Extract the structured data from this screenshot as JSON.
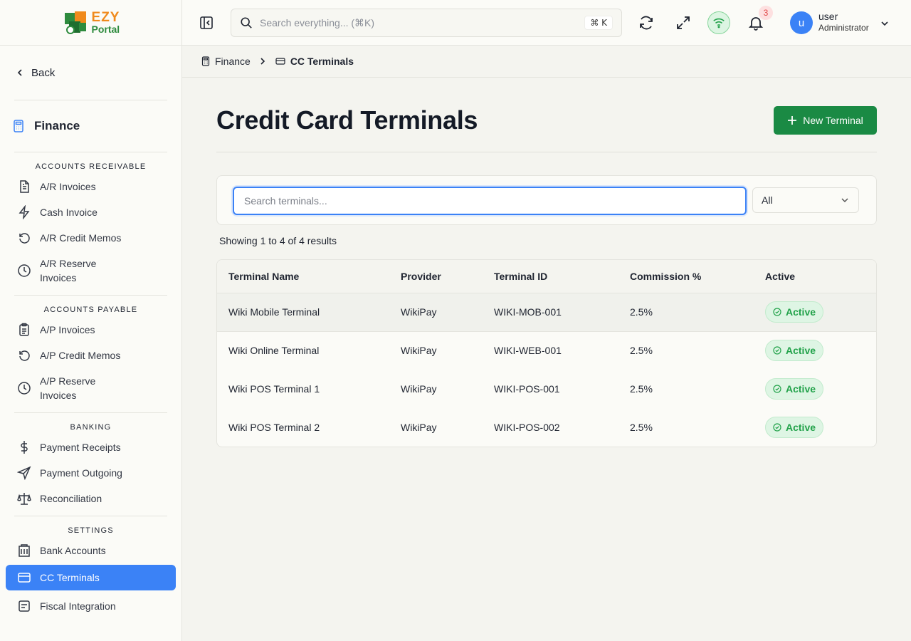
{
  "app": {
    "logo_line1": "EZY",
    "logo_line2": "Portal"
  },
  "sidebar": {
    "back_label": "Back",
    "section_title": "Finance",
    "groups": [
      {
        "title": "ACCOUNTS RECEIVABLE",
        "items": [
          {
            "label": "A/R Invoices",
            "icon": "document-icon"
          },
          {
            "label": "Cash Invoice",
            "icon": "lightning-icon"
          },
          {
            "label": "A/R Credit Memos",
            "icon": "rotate-ccw-icon"
          },
          {
            "label": "A/R Reserve Invoices",
            "icon": "clock-icon"
          }
        ]
      },
      {
        "title": "ACCOUNTS PAYABLE",
        "items": [
          {
            "label": "A/P Invoices",
            "icon": "clipboard-icon"
          },
          {
            "label": "A/P Credit Memos",
            "icon": "rotate-ccw-icon"
          },
          {
            "label": "A/P Reserve Invoices",
            "icon": "clock-icon"
          }
        ]
      },
      {
        "title": "BANKING",
        "items": [
          {
            "label": "Payment Receipts",
            "icon": "dollar-icon"
          },
          {
            "label": "Payment Outgoing",
            "icon": "send-icon"
          },
          {
            "label": "Reconciliation",
            "icon": "scale-icon"
          }
        ]
      },
      {
        "title": "SETTINGS",
        "items": [
          {
            "label": "Bank Accounts",
            "icon": "bank-icon"
          },
          {
            "label": "CC Terminals",
            "icon": "credit-card-icon",
            "active": true
          },
          {
            "label": "Fiscal Integration",
            "icon": "receipt-icon"
          }
        ]
      }
    ]
  },
  "topbar": {
    "search_placeholder": "Search everything... (⌘K)",
    "kbd_hint": "⌘ K",
    "notification_count": "3",
    "user_initial": "u",
    "user_name": "user",
    "user_role": "Administrator"
  },
  "breadcrumb": {
    "parent": "Finance",
    "current": "CC Terminals"
  },
  "main": {
    "title": "Credit Card Terminals",
    "new_button": "New Terminal",
    "search_placeholder": "Search terminals...",
    "filter_value": "All",
    "results_text": "Showing 1 to 4 of 4 results",
    "columns": [
      "Terminal Name",
      "Provider",
      "Terminal ID",
      "Commission %",
      "Active"
    ],
    "rows": [
      {
        "name": "Wiki Mobile Terminal",
        "provider": "WikiPay",
        "terminal_id": "WIKI-MOB-001",
        "commission": "2.5%",
        "status": "Active"
      },
      {
        "name": "Wiki Online Terminal",
        "provider": "WikiPay",
        "terminal_id": "WIKI-WEB-001",
        "commission": "2.5%",
        "status": "Active"
      },
      {
        "name": "Wiki POS Terminal 1",
        "provider": "WikiPay",
        "terminal_id": "WIKI-POS-001",
        "commission": "2.5%",
        "status": "Active"
      },
      {
        "name": "Wiki POS Terminal 2",
        "provider": "WikiPay",
        "terminal_id": "WIKI-POS-002",
        "commission": "2.5%",
        "status": "Active"
      }
    ]
  },
  "colors": {
    "accent": "#3b82f6",
    "primary_button": "#1a8a44",
    "status_green": "#22a24a"
  }
}
